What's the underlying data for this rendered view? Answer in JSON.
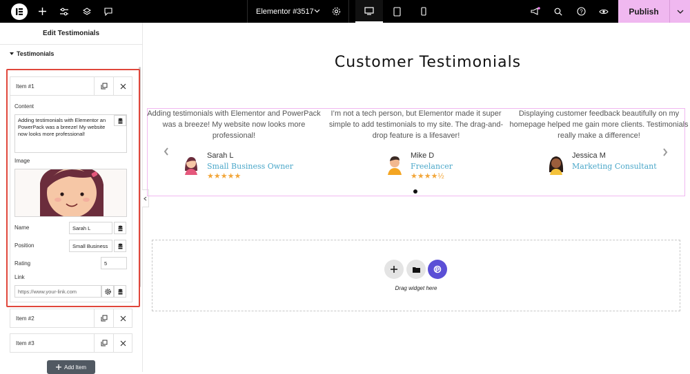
{
  "topbar": {
    "doc_title": "Elementor #3517",
    "publish_label": "Publish"
  },
  "panel": {
    "title": "Edit Testimonials",
    "section": "Testimonials",
    "item1": {
      "label": "Item #1",
      "content_label": "Content",
      "content_lines": [
        "Adding testimonials with Elementor an",
        "PowerPack was a breeze! My website",
        "now looks more professional!"
      ],
      "image_label": "Image",
      "name_label": "Name",
      "name_value": "Sarah L",
      "position_label": "Position",
      "position_value": "Small Business",
      "rating_label": "Rating",
      "rating_value": "5",
      "link_label": "Link",
      "link_placeholder": "https://www.your-link.com"
    },
    "item2_label": "Item #2",
    "item3_label": "Item #3",
    "add_item_label": "Add Item"
  },
  "canvas": {
    "title": "Customer Testimonials",
    "testimonials": [
      {
        "text": "Adding testimonials with Elementor and PowerPack was a breeze! My website now looks more professional!",
        "name": "Sarah L",
        "position": "Small Business Owner",
        "stars": "★★★★★",
        "rating": 5
      },
      {
        "text": "I’m not a tech person, but Elementor made it super simple to add testimonials to my site. The drag-and-drop feature is a lifesaver!",
        "name": "Mike D",
        "position": "Freelancer",
        "stars": "★★★★½",
        "rating": 4.5
      },
      {
        "text": "Displaying customer feedback beautifully on my homepage helped me gain more clients. Testimonials really make a difference!",
        "name": "Jessica M",
        "position": "Marketing Consultant",
        "stars": "",
        "rating": 0
      }
    ],
    "drag_text": "Drag widget here"
  },
  "colors": {
    "accent": "#f0b8f0",
    "highlight": "#e0463b",
    "position_text": "#4aa7c9",
    "star": "#f2a63a",
    "pp_button": "#5b4fd6"
  }
}
